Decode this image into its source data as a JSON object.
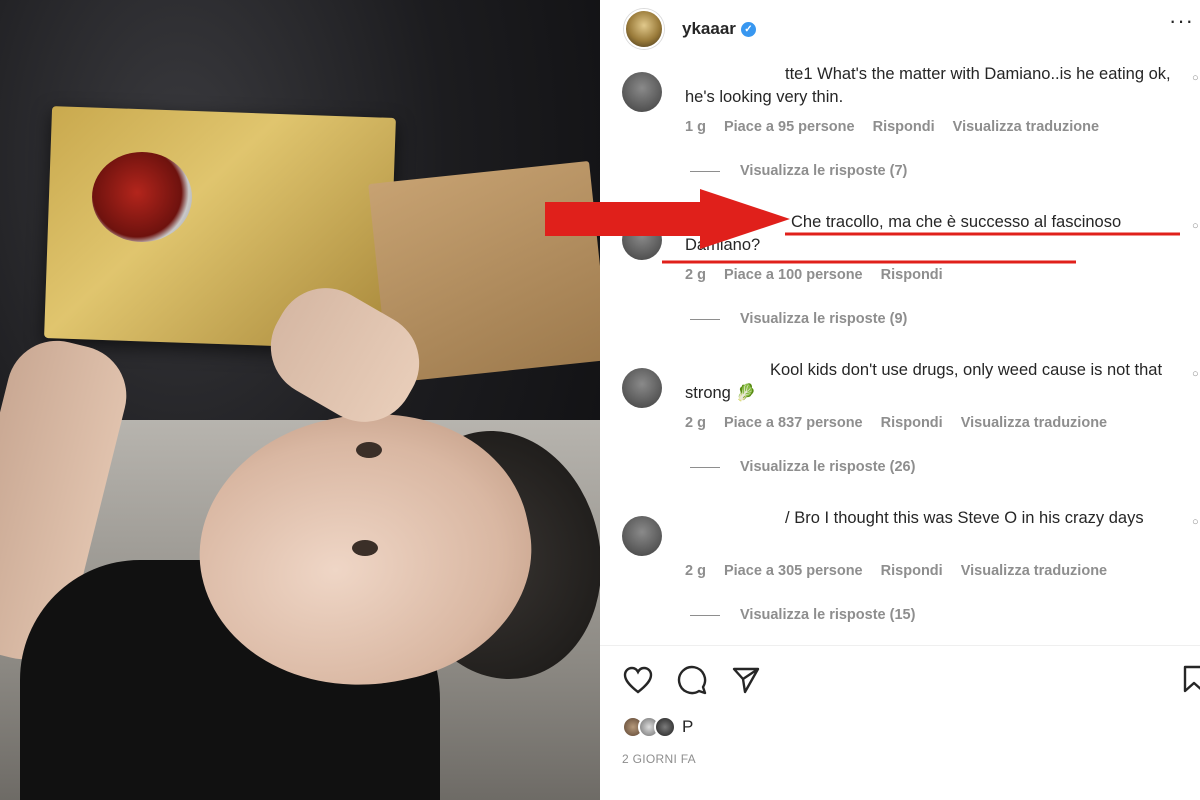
{
  "post": {
    "username": "ykaaar",
    "verified_badge": "✓",
    "more_glyph": "···"
  },
  "comments": [
    {
      "user": "tte1",
      "text": "What's the matter with Damiano..is he eating ok, he's looking very thin.",
      "age": "1 g",
      "likes": "Piace a 95 persone",
      "reply": "Rispondi",
      "translate": "Visualizza traduzione",
      "view_replies": "Visualizza le risposte (7)"
    },
    {
      "user": "",
      "text": "Che tracollo, ma che è successo al fascinoso Damiano?",
      "age": "2 g",
      "likes": "Piace a 100 persone",
      "reply": "Rispondi",
      "translate": "",
      "view_replies": "Visualizza le risposte (9)"
    },
    {
      "user": "",
      "text": "Kool kids don't use drugs, only weed cause is not that strong 🥬",
      "age": "2 g",
      "likes": "Piace a 837 persone",
      "reply": "Rispondi",
      "translate": "Visualizza traduzione",
      "view_replies": "Visualizza le risposte (26)"
    },
    {
      "user": "/",
      "text": "Bro I thought this was Steve O in his crazy days",
      "age": "2 g",
      "likes": "Piace a 305 persone",
      "reply": "Rispondi",
      "translate": "Visualizza traduzione",
      "view_replies": "Visualizza le risposte (15)"
    }
  ],
  "footer": {
    "likes_text": "P",
    "date": "2 GIORNI FA"
  },
  "icons": {
    "like": "heart-icon",
    "comment": "comment-icon",
    "share": "share-icon",
    "save": "bookmark-icon"
  },
  "colors": {
    "verified": "#3897f0",
    "meta": "#8e8e8e",
    "annotation": "#e0201b"
  }
}
